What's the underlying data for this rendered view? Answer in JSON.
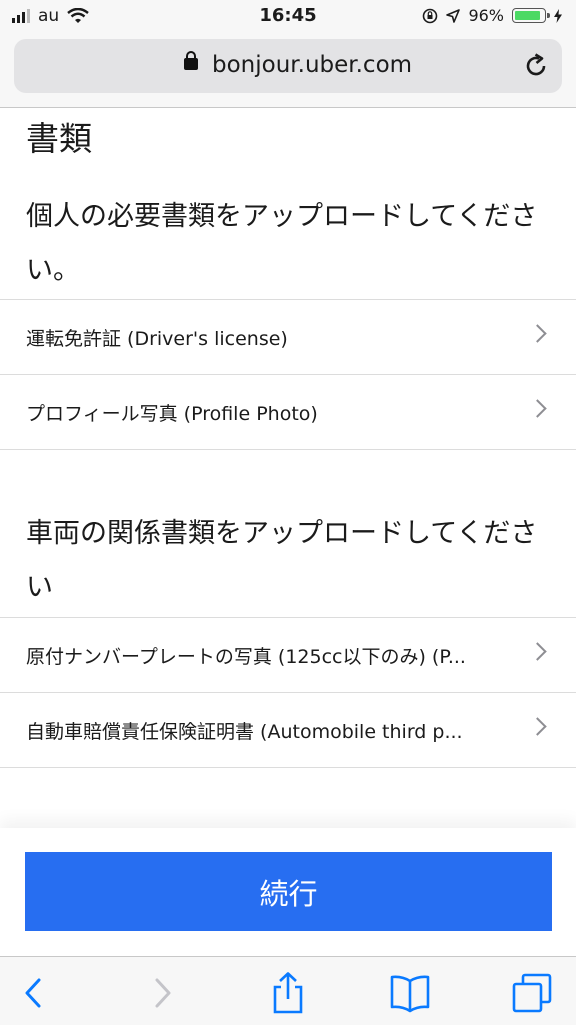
{
  "status_bar": {
    "carrier": "au",
    "time": "16:45",
    "battery": "96%",
    "battery_level": 0.96
  },
  "browser": {
    "url": "bonjour.uber.com",
    "icons": [
      "lock-icon",
      "reload-icon",
      "back-icon",
      "forward-icon",
      "share-icon",
      "bookmarks-icon",
      "tabs-icon"
    ]
  },
  "page": {
    "title": "書類",
    "personal_heading": "個人の必要書類をアップロードしてください。",
    "personal_items": [
      "運転免許証 (Driver's license)",
      "プロフィール写真 (Profile Photo)"
    ],
    "vehicle_heading": "車両の関係書類をアップロードしてください",
    "vehicle_items": [
      "原付ナンバープレートの写真 (125cc以下のみ) (P...",
      "自動車賠償責任保険証明書 (Automobile third p..."
    ],
    "continue_label": "続行"
  },
  "colors": {
    "accent": "#276ef1",
    "battery": "#4cd964"
  }
}
